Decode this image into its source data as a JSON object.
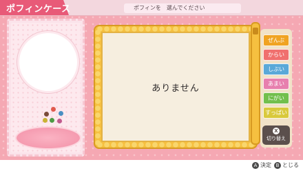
{
  "header": {
    "title": "ポフィンケース",
    "prompt": "ポフィンを　選んでください"
  },
  "case_panel": {
    "flavor_dots": [
      {
        "name": "red-dot",
        "color": "#e05a4d"
      },
      {
        "name": "brown-dot",
        "color": "#7a4b3a"
      },
      {
        "name": "blue-dot",
        "color": "#4a8fc2"
      },
      {
        "name": "yellow-dot",
        "color": "#c9b234"
      },
      {
        "name": "green-dot",
        "color": "#4e9a44"
      },
      {
        "name": "pink-dot",
        "color": "#c05a8e"
      }
    ]
  },
  "card": {
    "empty_text": "ありません"
  },
  "filters": [
    {
      "label": "ぜんぶ",
      "color": "#f0a322"
    },
    {
      "label": "からい",
      "color": "#f0706e"
    },
    {
      "label": "しぶい",
      "color": "#5aa8d8"
    },
    {
      "label": "あまい",
      "color": "#e77fae"
    },
    {
      "label": "にがい",
      "color": "#72bf4d"
    },
    {
      "label": "すっぱい",
      "color": "#d9c93c"
    }
  ],
  "switch_button": {
    "key": "X",
    "label": "切り替え"
  },
  "hints": {
    "confirm_key": "A",
    "confirm_label": "決定",
    "close_key": "B",
    "close_label": "とじる"
  }
}
